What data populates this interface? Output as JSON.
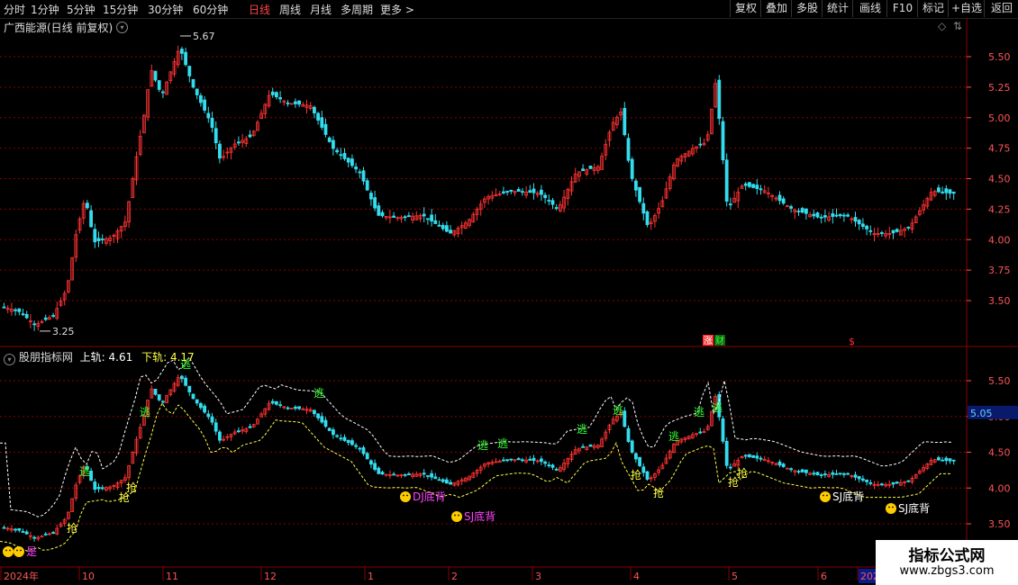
{
  "toolbar": {
    "periods": [
      "分时",
      "1分钟",
      "5分钟",
      "15分钟",
      "30分钟",
      "60分钟",
      "日线",
      "周线",
      "月线",
      "多周期",
      "更多 >"
    ],
    "active_period": "日线",
    "right_buttons": [
      "复权",
      "叠加",
      "多股",
      "统计",
      "画线",
      "F10",
      "标记",
      "+自选",
      "返回"
    ]
  },
  "main_chart": {
    "title": "广西能源(日线 前复权)",
    "y_ticks": [
      "5.50",
      "5.25",
      "5.00",
      "4.75",
      "4.50",
      "4.25",
      "4.00",
      "3.75",
      "3.50"
    ],
    "high_label": "5.67",
    "low_label": "3.25",
    "markers": [
      {
        "text": "涨",
        "color": "#ff3333"
      },
      {
        "text": "财",
        "color": "#33ff33"
      },
      {
        "text": "$",
        "color": "#ff3333"
      }
    ]
  },
  "indicator_chart": {
    "title": "股朋指标网",
    "upper_label": "上轨:",
    "upper_value": "4.61",
    "lower_label": "下轨:",
    "lower_value": "4.17",
    "y_ticks": [
      "5.50",
      "5.00",
      "4.50",
      "4.00",
      "3.50"
    ],
    "current_price_tag": "5.05",
    "signals": {
      "escape": "逃",
      "grab": "抢",
      "dj_bottom": "DJ底背",
      "sj_bottom": "SJ底背",
      "yes": "是"
    }
  },
  "x_axis": {
    "labels": [
      "2024年",
      "10",
      "11",
      "12",
      "1",
      "2",
      "3",
      "4",
      "5",
      "6",
      "2025"
    ]
  },
  "watermark": {
    "line1": "指标公式网",
    "line2": "www.zbgs3.com"
  },
  "colors": {
    "up": "#ff3333",
    "down": "#33ddee",
    "grid": "#8b0000",
    "axis_text": "#ff5555",
    "upper_band": "#ffffff",
    "lower_band": "#ffff44",
    "escape": "#33ff33",
    "grab": "#ffff44",
    "magenta": "#ff44ff"
  }
}
